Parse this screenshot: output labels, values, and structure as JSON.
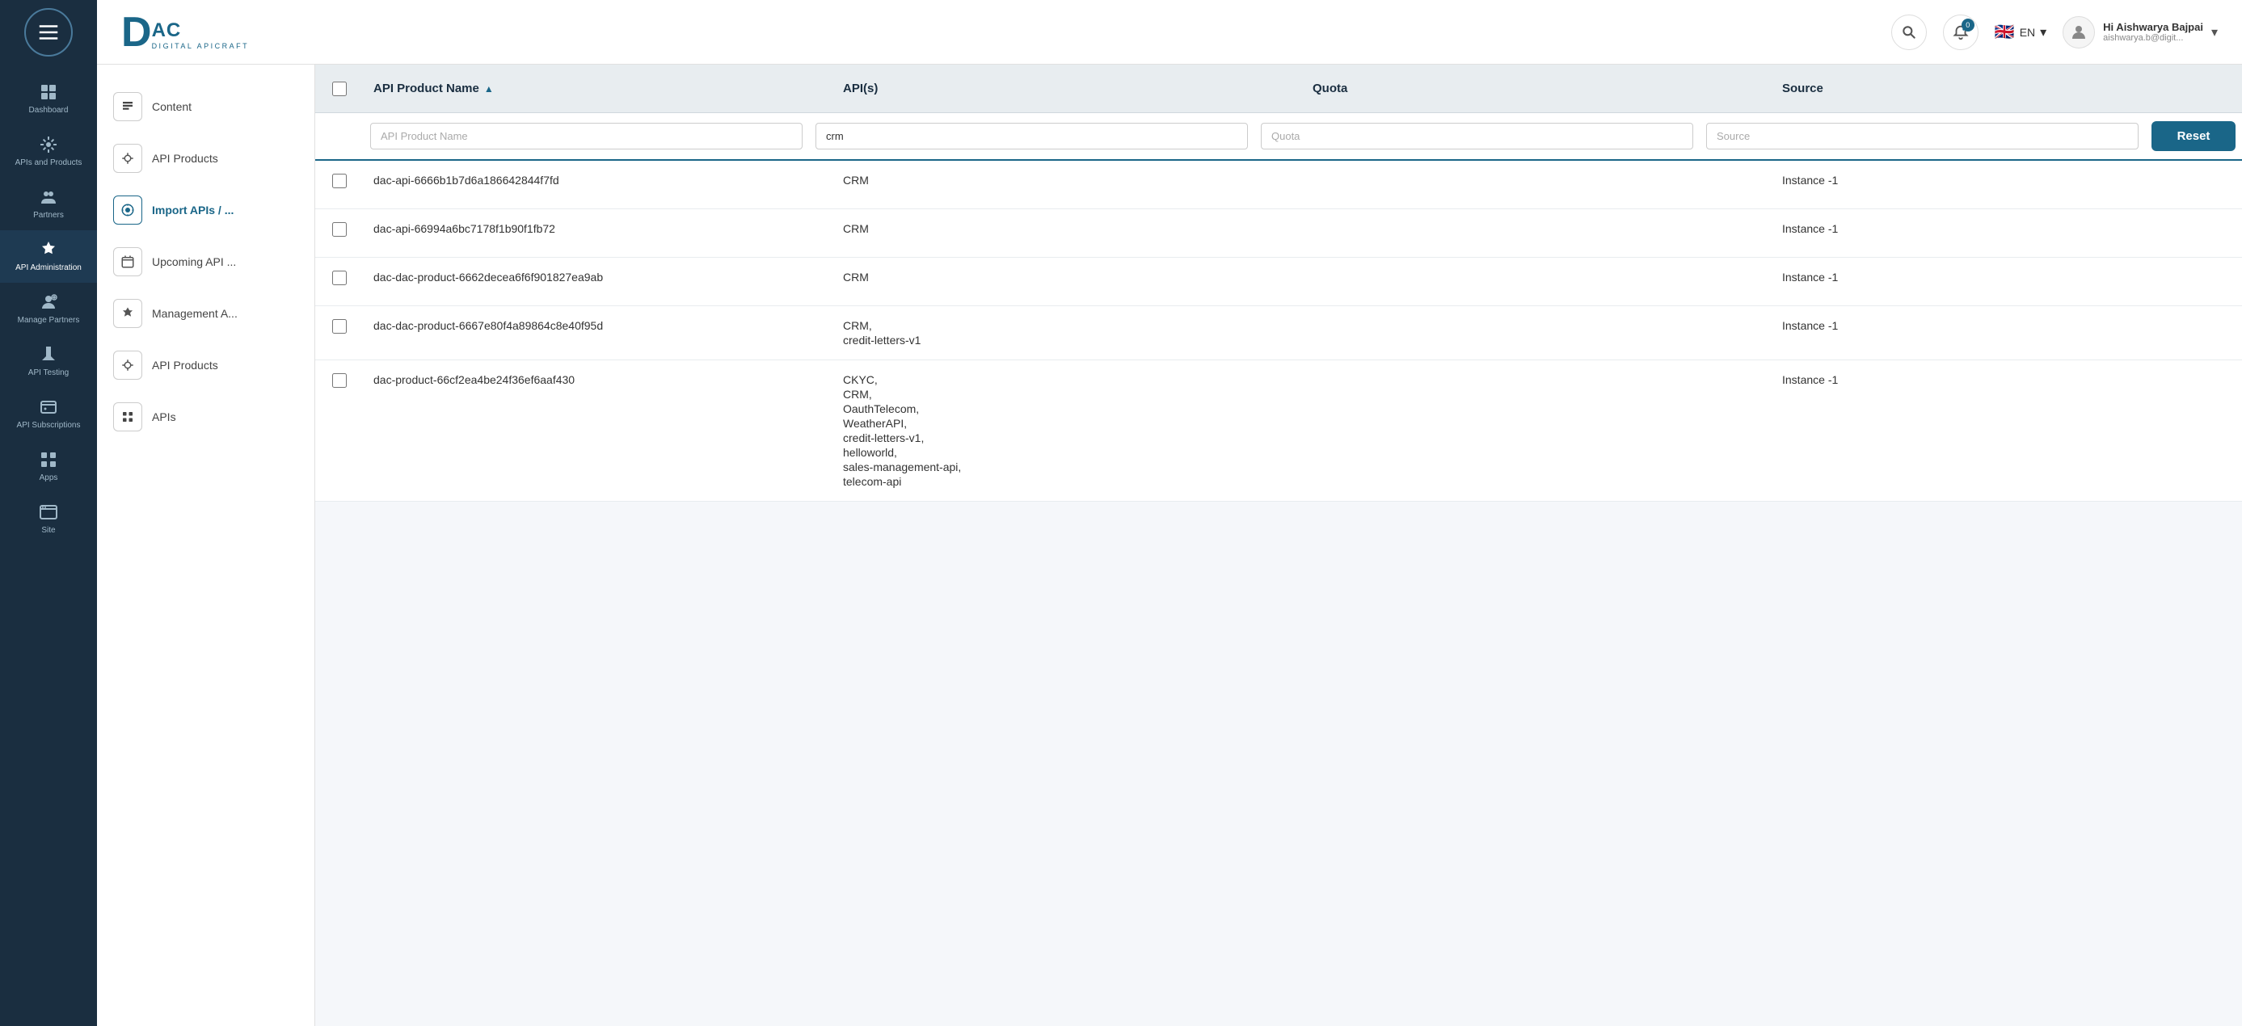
{
  "header": {
    "logo_text": "DAC",
    "logo_sub": "DIGITAL APICRAFT",
    "search_aria": "Search",
    "notif_count": "0",
    "lang": "EN",
    "user_greeting": "Hi Aishwarya Bajpai",
    "user_email": "aishwarya.b@digit..."
  },
  "sidebar": {
    "items": [
      {
        "label": "Dashboard",
        "icon": "dashboard"
      },
      {
        "label": "APIs and Products",
        "icon": "api"
      },
      {
        "label": "Partners",
        "icon": "partners"
      },
      {
        "label": "API Administration",
        "icon": "admin",
        "active": true
      },
      {
        "label": "Manage Partners",
        "icon": "manage"
      },
      {
        "label": "API Testing",
        "icon": "testing"
      },
      {
        "label": "API Subscriptions",
        "icon": "subscriptions"
      },
      {
        "label": "Apps",
        "icon": "apps"
      },
      {
        "label": "Site",
        "icon": "site"
      }
    ]
  },
  "secondary_sidebar": {
    "items": [
      {
        "label": "Content",
        "icon": "content"
      },
      {
        "label": "API Products",
        "icon": "api-products",
        "first": true
      },
      {
        "label": "Import APIs / ...",
        "icon": "import",
        "active": true
      },
      {
        "label": "Upcoming API ...",
        "icon": "upcoming"
      },
      {
        "label": "Management A...",
        "icon": "management"
      },
      {
        "label": "API Products",
        "icon": "api-products2",
        "second": true
      },
      {
        "label": "APIs",
        "icon": "apis"
      }
    ]
  },
  "table": {
    "columns": {
      "checkbox": "",
      "api_product_name": "API Product Name",
      "apis": "API(s)",
      "quota": "Quota",
      "source": "Source"
    },
    "filters": {
      "api_product_name_placeholder": "API Product Name",
      "apis_value": "crm",
      "quota_placeholder": "Quota",
      "source_placeholder": "Source",
      "reset_label": "Reset"
    },
    "rows": [
      {
        "api_product_name": "dac-api-6666b1b7d6a186642844f7fd",
        "apis": [
          "CRM"
        ],
        "quota": "",
        "source": "Instance -1"
      },
      {
        "api_product_name": "dac-api-66994a6bc7178f1b90f1fb72",
        "apis": [
          "CRM"
        ],
        "quota": "",
        "source": "Instance -1"
      },
      {
        "api_product_name": "dac-dac-product-6662decea6f6f901827ea9ab",
        "apis": [
          "CRM"
        ],
        "quota": "",
        "source": "Instance -1"
      },
      {
        "api_product_name": "dac-dac-product-6667e80f4a89864c8e40f95d",
        "apis": [
          "CRM,",
          "credit-letters-v1"
        ],
        "quota": "",
        "source": "Instance -1"
      },
      {
        "api_product_name": "dac-product-66cf2ea4be24f36ef6aaf430",
        "apis": [
          "CKYC,",
          "CRM,",
          "OauthTelecom,",
          "WeatherAPI,",
          "credit-letters-v1,",
          "helloworld,",
          "sales-management-api,",
          "telecom-api"
        ],
        "quota": "",
        "source": "Instance -1"
      }
    ]
  }
}
